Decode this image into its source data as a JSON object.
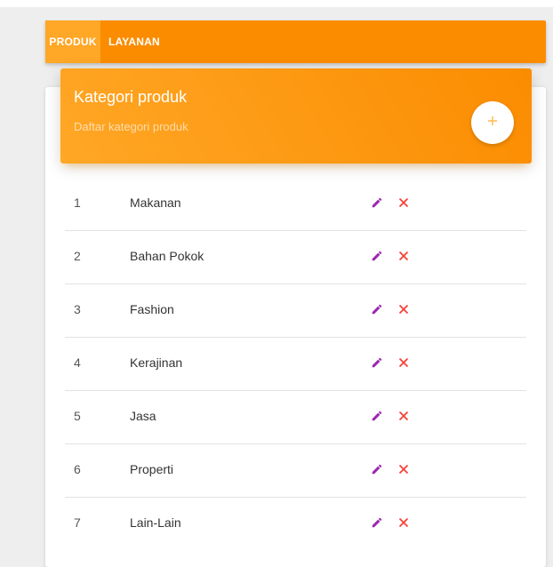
{
  "tabs": [
    {
      "label": "PRODUK",
      "active": true
    },
    {
      "label": "LAYANAN",
      "active": false
    }
  ],
  "header": {
    "title": "Kategori produk",
    "subtitle": "Daftar kategori produk",
    "add_icon": "plus-icon"
  },
  "table": {
    "rows": [
      {
        "no": "1",
        "name": "Makanan"
      },
      {
        "no": "2",
        "name": "Bahan Pokok"
      },
      {
        "no": "3",
        "name": "Fashion"
      },
      {
        "no": "4",
        "name": "Kerajinan"
      },
      {
        "no": "5",
        "name": "Jasa"
      },
      {
        "no": "6",
        "name": "Properti"
      },
      {
        "no": "7",
        "name": "Lain-Lain"
      }
    ],
    "edit_icon": "pencil-icon",
    "delete_icon": "close-icon"
  },
  "colors": {
    "accent": "#fb8c00",
    "accent_light": "#ffa726",
    "edit": "#9c27b0",
    "delete": "#f44336"
  }
}
